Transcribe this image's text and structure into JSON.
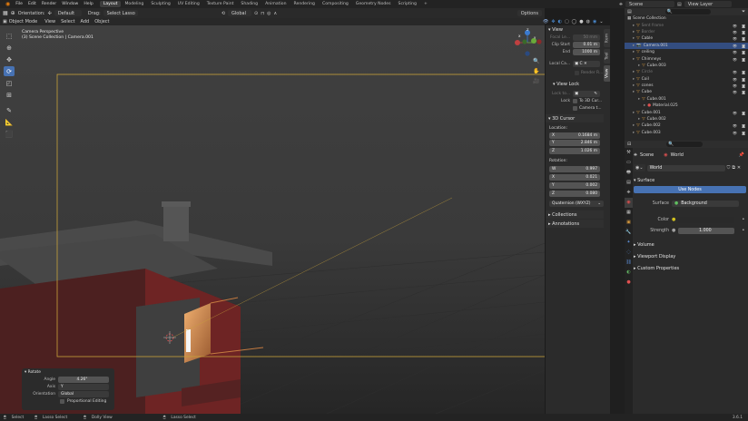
{
  "topbar": {
    "menus": [
      "File",
      "Edit",
      "Render",
      "Window",
      "Help"
    ],
    "workspaces": [
      "Layout",
      "Modeling",
      "Sculpting",
      "UV Editing",
      "Texture Paint",
      "Shading",
      "Animation",
      "Rendering",
      "Compositing",
      "Geometry Nodes",
      "Scripting"
    ],
    "active_workspace": "Layout",
    "add_tab": "+",
    "scene": "Scene",
    "view_layer": "View Layer"
  },
  "viewport_header": {
    "orientation_label": "Orientation:",
    "orientation_value": "Default",
    "drag_label": "Drag:",
    "drag_value": "Select Lasso",
    "transform_orientation": "Global",
    "options_label": "Options"
  },
  "viewport_header2": {
    "mode": "Object Mode",
    "menus": [
      "View",
      "Select",
      "Add",
      "Object"
    ]
  },
  "viewport": {
    "camera_title": "Camera Perspective",
    "collection_path": "(3) Scene Collection | Camera.001",
    "gizmo_labels": {
      "x": "X",
      "y": "Y",
      "z": "Z"
    }
  },
  "npanel": {
    "tabs": [
      "Item",
      "Tool",
      "View"
    ],
    "view_section": "View",
    "focal_length_label": "Focal Le...",
    "focal_length_value": "50 mm",
    "clip_start_label": "Clip Start",
    "clip_start_value": "0.01 m",
    "clip_end_label": "End",
    "clip_end_value": "1000 m",
    "local_camera_label": "Local Ca...",
    "render_region_label": "Render R...",
    "view_lock_section": "View Lock",
    "lock_to_label": "Lock to...",
    "lock_label": "Lock",
    "to_3d_cursor_label": "To 3D Cur...",
    "camera_to_view_label": "Camera t...",
    "cursor_section": "3D Cursor",
    "location_label": "Location:",
    "loc_x_label": "X",
    "loc_x": "0.1684 m",
    "loc_y_label": "Y",
    "loc_y": "2.846 m",
    "loc_z_label": "Z",
    "loc_z": "1.026 m",
    "rotation_label": "Rotation:",
    "rot_w_label": "W",
    "rot_w": "0.997",
    "rot_x_label": "X",
    "rot_x": "0.021",
    "rot_y_label": "Y",
    "rot_y": "0.002",
    "rot_z_label": "Z",
    "rot_z": "0.080",
    "rotation_mode": "Quaternion (WXYZ)",
    "collections_section": "Collections",
    "annotations_section": "Annotations"
  },
  "outliner": {
    "root": "Scene Collection",
    "items": [
      {
        "name": "Sent frame",
        "indent": 1,
        "icon": "▽",
        "dim": true
      },
      {
        "name": "Border",
        "indent": 1,
        "icon": "▽",
        "dim": true
      },
      {
        "name": "Cable",
        "indent": 1,
        "icon": "▽",
        "dim": false
      },
      {
        "name": "Camera.001",
        "indent": 1,
        "icon": "📷",
        "dim": false,
        "selected": true
      },
      {
        "name": "ceiling",
        "indent": 1,
        "icon": "▽",
        "dim": false
      },
      {
        "name": "Chimneys",
        "indent": 1,
        "icon": "▽",
        "dim": false
      },
      {
        "name": "Cube.003",
        "indent": 2,
        "icon": "▽",
        "dim": false
      },
      {
        "name": "Circle",
        "indent": 1,
        "icon": "▽",
        "dim": true
      },
      {
        "name": "Coil",
        "indent": 1,
        "icon": "▽",
        "dim": false
      },
      {
        "name": "cones",
        "indent": 1,
        "icon": "▽",
        "dim": false
      },
      {
        "name": "Cube",
        "indent": 1,
        "icon": "▽",
        "dim": false
      },
      {
        "name": "Cube.001",
        "indent": 2,
        "icon": "▽",
        "dim": false
      },
      {
        "name": "Material.025",
        "indent": 3,
        "icon": "●",
        "dim": false
      },
      {
        "name": "Cube.001",
        "indent": 1,
        "icon": "▽",
        "dim": false
      },
      {
        "name": "Cube.002",
        "indent": 2,
        "icon": "▽",
        "dim": false
      },
      {
        "name": "Cube.002",
        "indent": 1,
        "icon": "▽",
        "dim": false
      },
      {
        "name": "Cube.003",
        "indent": 1,
        "icon": "▽",
        "dim": false
      }
    ]
  },
  "properties": {
    "breadcrumb_scene": "Scene",
    "breadcrumb_world": "World",
    "world_name": "World",
    "surface_section": "Surface",
    "use_nodes_label": "Use Nodes",
    "surface_label": "Surface",
    "surface_value": "Background",
    "color_label": "Color",
    "strength_label": "Strength",
    "strength_value": "1.000",
    "volume_section": "Volume",
    "viewport_display_section": "Viewport Display",
    "custom_properties_section": "Custom Properties"
  },
  "redo_panel": {
    "title": "Rotate",
    "angle_label": "Angle",
    "angle_value": "4.26°",
    "axis_label": "Axis",
    "axis_value": "Y",
    "orientation_label": "Orientation",
    "orientation_value": "Global",
    "proportional_label": "Proportional Editing"
  },
  "statusbar": {
    "items": [
      "Select",
      "Lasso Select",
      "Dolly View",
      "Lasso Select"
    ],
    "version": "3.6.1"
  },
  "colors": {
    "accent": "#4772b3",
    "selected_row": "#334d80",
    "camera_frame": "#c8a23a",
    "house_red": "#7a2626",
    "window_glow": "#d49a5a"
  }
}
